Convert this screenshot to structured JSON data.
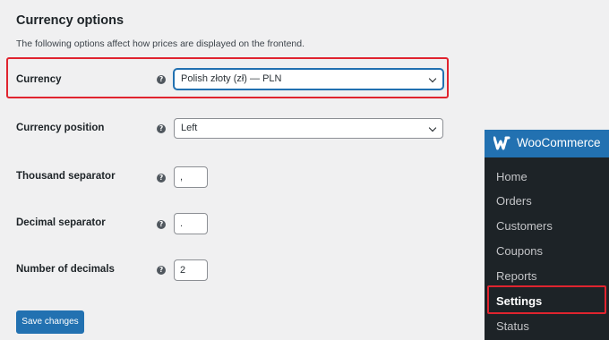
{
  "section": {
    "title": "Currency options",
    "description": "The following options affect how prices are displayed on the frontend."
  },
  "fields": {
    "currency": {
      "label": "Currency",
      "value": "Polish złoty (zł) — PLN"
    },
    "position": {
      "label": "Currency position",
      "value": "Left"
    },
    "thousand": {
      "label": "Thousand separator",
      "value": ","
    },
    "decimal": {
      "label": "Decimal separator",
      "value": "."
    },
    "decimals": {
      "label": "Number of decimals",
      "value": "2"
    }
  },
  "help_glyph": "?",
  "save_label": "Save changes",
  "sidebar": {
    "title": "WooCommerce",
    "items": [
      "Home",
      "Orders",
      "Customers",
      "Coupons",
      "Reports",
      "Settings",
      "Status"
    ],
    "active": "Settings"
  },
  "colors": {
    "accent": "#2271b1",
    "highlight": "#e0242f",
    "sidebar_bg": "#1d2327",
    "page_bg": "#f0f0f1"
  }
}
